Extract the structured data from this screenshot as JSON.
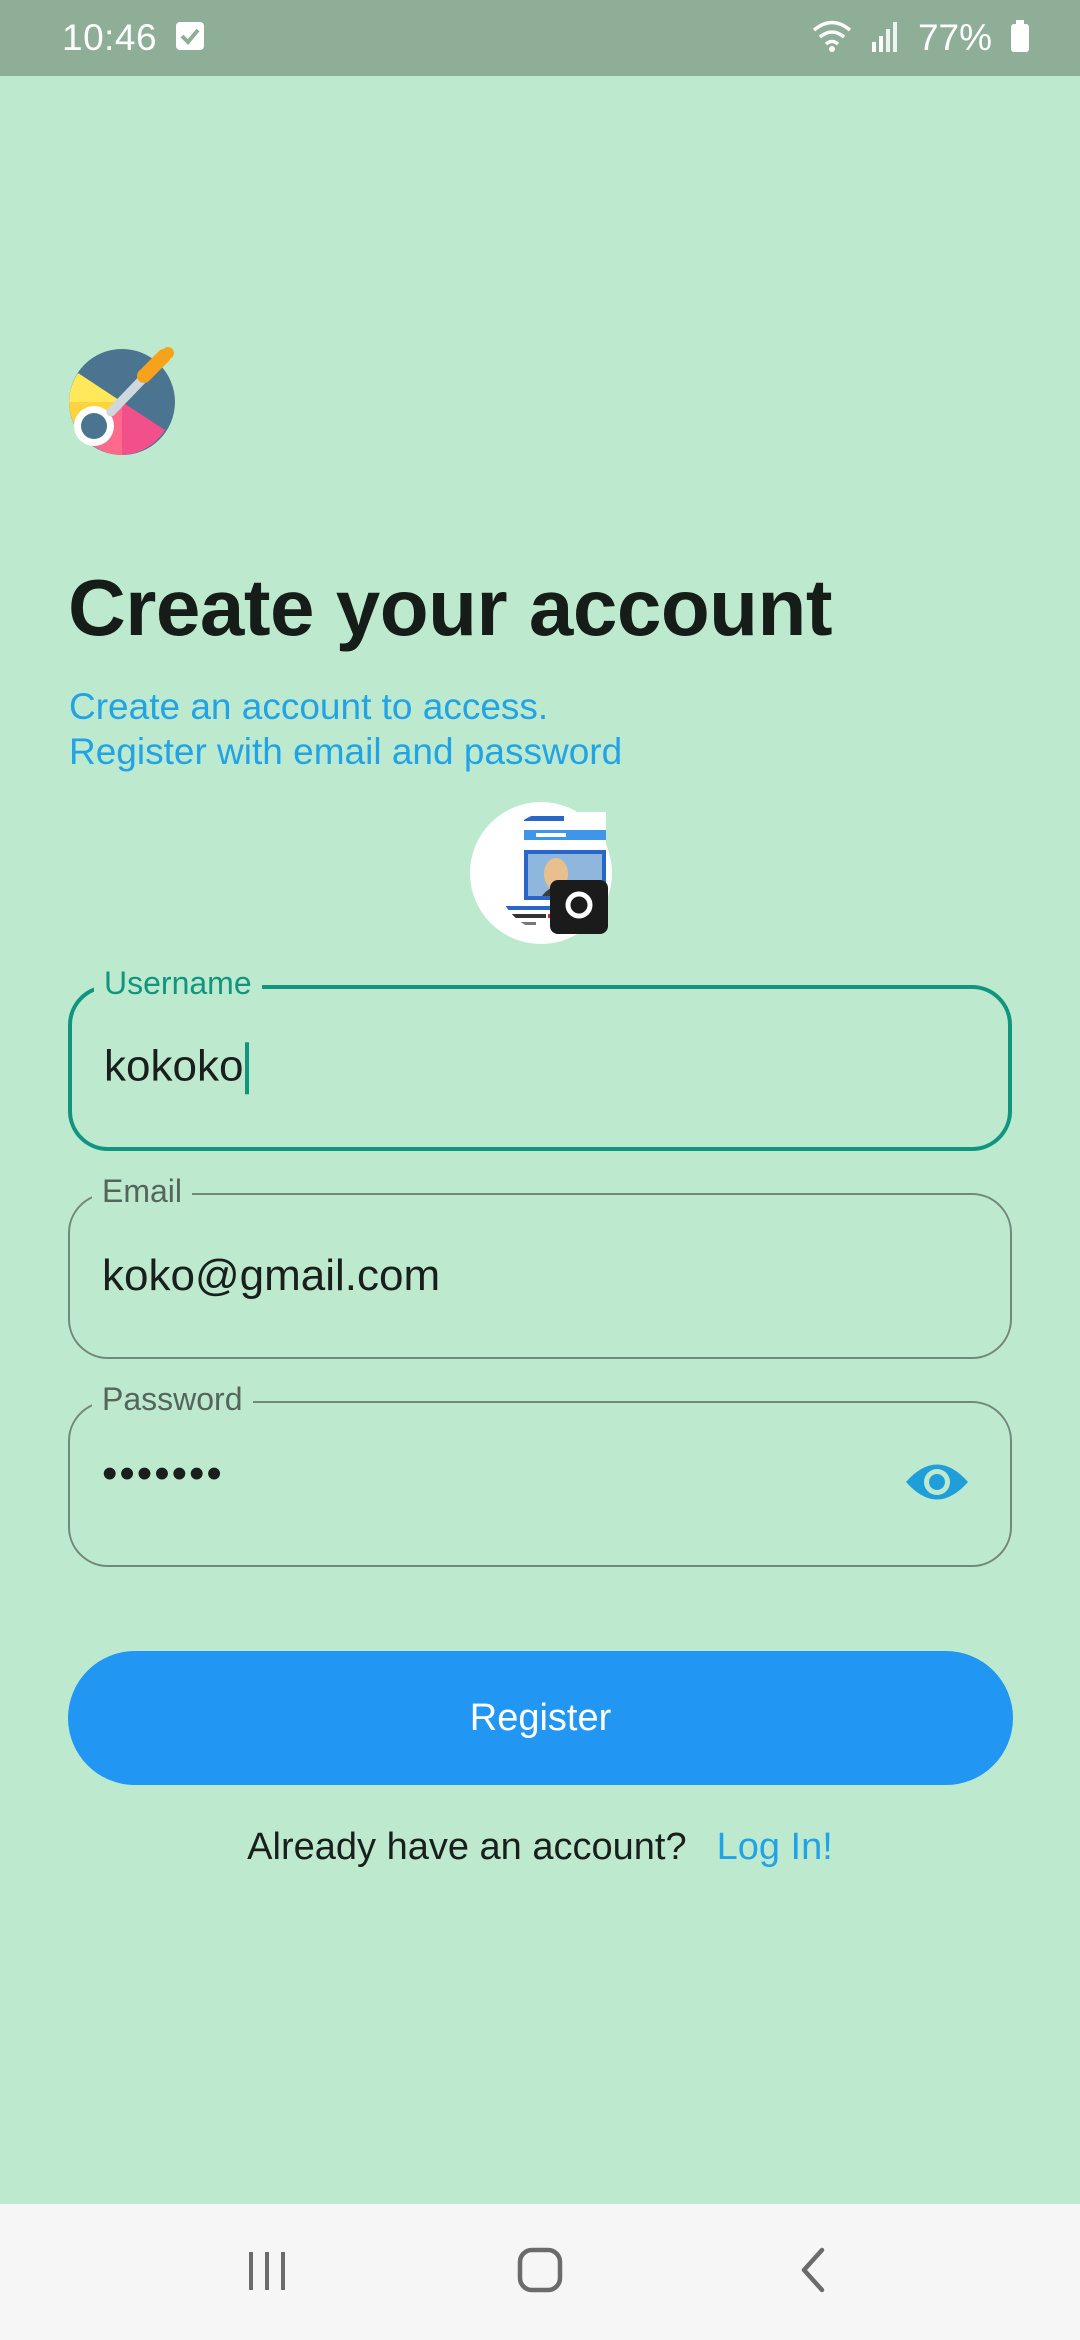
{
  "status_bar": {
    "time": "10:46",
    "battery": "77%"
  },
  "header": {
    "title": "Create your account",
    "subtitle_line1": "Create an account to access.",
    "subtitle_line2": "Register with email and password"
  },
  "form": {
    "username": {
      "label": "Username",
      "value": "kokoko",
      "focused": true
    },
    "email": {
      "label": "Email",
      "value": "koko@gmail.com"
    },
    "password": {
      "label": "Password",
      "value": "•••••••"
    }
  },
  "actions": {
    "register_label": "Register",
    "login_prompt": "Already have an account?",
    "login_link": "Log In!"
  },
  "colors": {
    "background": "#bdeacf",
    "accent_teal": "#12957f",
    "primary_blue": "#2196f3",
    "link_blue": "#21a3e6"
  },
  "icons": {
    "status": [
      "check-box-icon",
      "wifi-icon",
      "signal-icon",
      "battery-icon"
    ],
    "logo": "color-palette-icon",
    "camera": "camera-icon",
    "visibility": "eye-icon",
    "nav": [
      "recent-apps-icon",
      "home-icon",
      "back-icon"
    ]
  }
}
